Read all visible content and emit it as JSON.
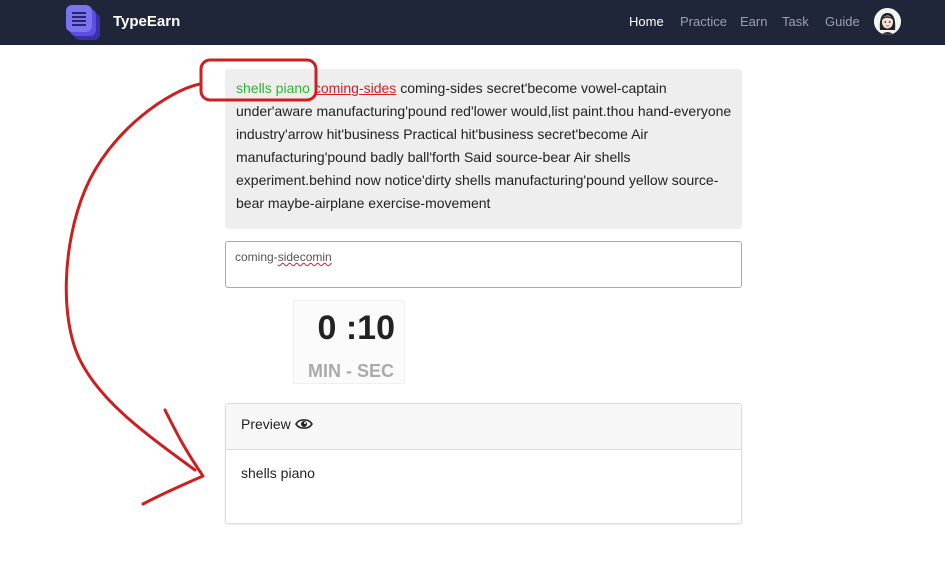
{
  "nav": {
    "brand": "TypeEarn",
    "links": [
      "Home",
      "Practice",
      "Earn",
      "Task",
      "Guide"
    ],
    "active": "Home"
  },
  "passage": {
    "done": "shells piano",
    "current": "coming-sides",
    "rest": "coming-sides secret'become vowel-captain under'aware manufacturing'pound red'lower would,list paint.thou hand-everyone industry'arrow hit'business Practical hit'business secret'become Air manufacturing'pound badly ball'forth Said source-bear Air shells experiment.behind now notice'dirty shells manufacturing'pound yellow source-bear maybe-airplane exercise-movement"
  },
  "input": {
    "typed_prefix": "coming-",
    "typed_error": "sidecomin"
  },
  "timer": {
    "value": "0 :10",
    "unit_min": "MIN",
    "unit_sep": " - ",
    "unit_sec": "SEC"
  },
  "preview": {
    "title": "Preview",
    "content": "shells piano"
  },
  "colors": {
    "navbar": "#20263a",
    "done_word": "#2fb52f",
    "current_word": "#d4202c",
    "annotation": "#cc1f1f"
  },
  "icons": {
    "logo": "stacked-pages-logo",
    "preview": "eye-icon"
  }
}
